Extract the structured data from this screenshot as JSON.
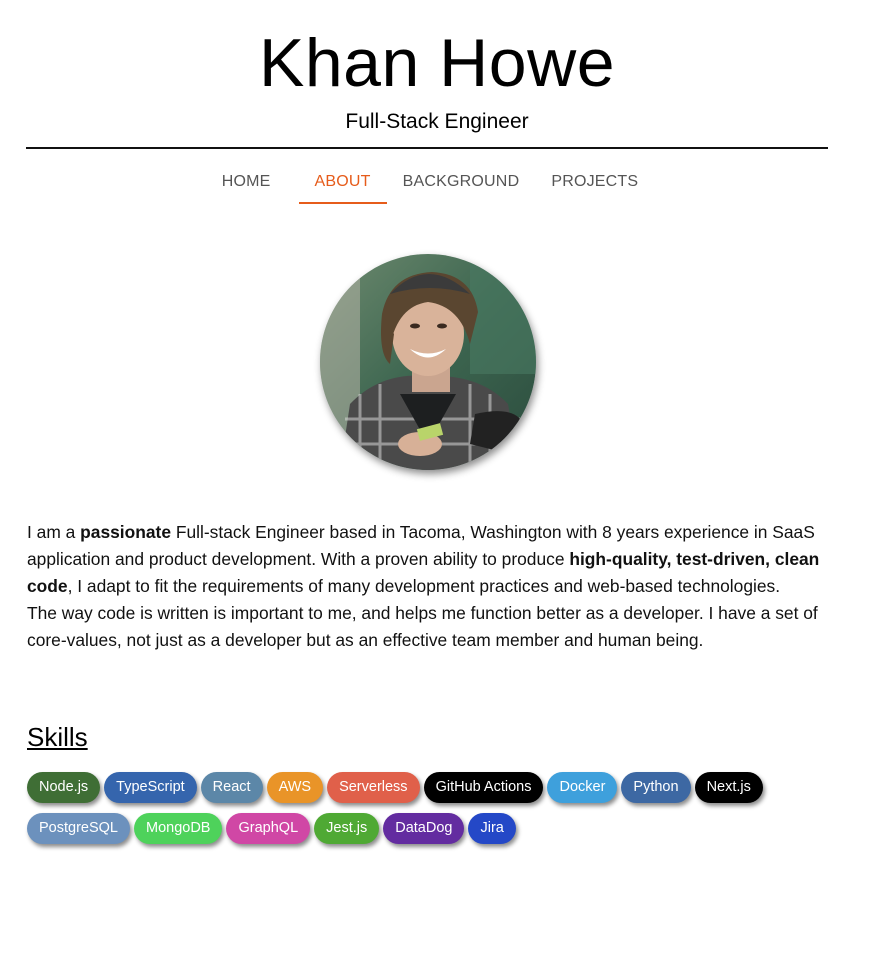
{
  "header": {
    "name": "Khan Howe",
    "title": "Full-Stack Engineer"
  },
  "nav": {
    "items": [
      {
        "label": "HOME",
        "active": false
      },
      {
        "label": "ABOUT",
        "active": true
      },
      {
        "label": "BACKGROUND",
        "active": false
      },
      {
        "label": "PROJECTS",
        "active": false
      }
    ],
    "accent_color": "#e65c1b"
  },
  "about": {
    "p1": [
      {
        "text": "I am a ",
        "bold": false
      },
      {
        "text": "passionate",
        "bold": true
      },
      {
        "text": " Full-stack Engineer based in Tacoma, Washington with 8 years experience in SaaS application and product development. With a proven ability to produce ",
        "bold": false
      },
      {
        "text": "high-quality, test-driven, clean code",
        "bold": true
      },
      {
        "text": ", I adapt to fit the requirements of many development practices and web-based technologies.",
        "bold": false
      }
    ],
    "p2": "The way code is written is important to me, and helps me function better as a developer. I have a set of core-values, not just as a developer but as an effective team member and human being."
  },
  "skills": {
    "heading": "Skills",
    "badges": [
      {
        "label": "Node.js",
        "color": "#3f6e35"
      },
      {
        "label": "TypeScript",
        "color": "#3565ad"
      },
      {
        "label": "React",
        "color": "#5c87a8"
      },
      {
        "label": "AWS",
        "color": "#e99428"
      },
      {
        "label": "Serverless",
        "color": "#e0604a"
      },
      {
        "label": "GitHub Actions",
        "color": "#000000"
      },
      {
        "label": "Docker",
        "color": "#3ea0dc"
      },
      {
        "label": "Python",
        "color": "#3d68a3"
      },
      {
        "label": "Next.js",
        "color": "#000000"
      },
      {
        "label": "PostgreSQL",
        "color": "#6c91bd"
      },
      {
        "label": "MongoDB",
        "color": "#4ed25b"
      },
      {
        "label": "GraphQL",
        "color": "#d047a5"
      },
      {
        "label": "Jest.js",
        "color": "#4fa934"
      },
      {
        "label": "DataDog",
        "color": "#632ca0"
      },
      {
        "label": "Jira",
        "color": "#2448c7"
      }
    ]
  }
}
